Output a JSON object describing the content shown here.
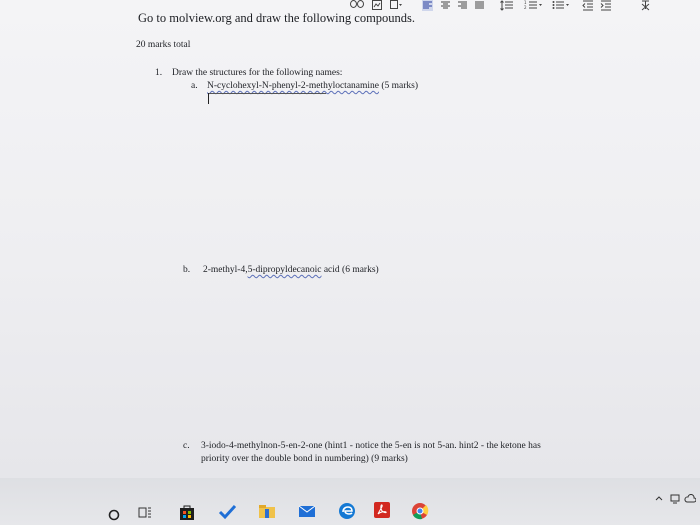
{
  "heading": "Go to molview.org and draw the following compounds.",
  "total_marks": "20 marks total",
  "question1": {
    "number": "1.",
    "text": "Draw the structures for the following names:",
    "a": {
      "letter": "a.",
      "name": "N-cyclohexyl-N-phenyl-2-methyloctanamine",
      "marks": "(5 marks)"
    },
    "b": {
      "letter": "b.",
      "name_prefix": "2-methyl-4,",
      "name_underlined": "5-dipropyldecanoic",
      "name_suffix": " acid (6 marks)"
    },
    "c": {
      "letter": "c.",
      "line1": "3-iodo-4-methylnon-5-en-2-one (hint1 - notice the 5-en is not 5-an. hint2 - the ketone has",
      "line2": "priority over the double bond in numbering) (9 marks)"
    }
  },
  "toolbar_icons": [
    "link-icon",
    "image-icon",
    "align-left-icon",
    "align-center-icon",
    "align-right-icon",
    "align-justify-icon",
    "line-spacing-icon",
    "numbered-list-icon",
    "bulleted-list-icon",
    "decrease-indent-icon",
    "increase-indent-icon",
    "clear-formatting-icon"
  ],
  "taskbar_icons": [
    "start-icon",
    "task-view-icon",
    "store-icon",
    "pinned-app-icon",
    "explorer-icon",
    "mail-icon",
    "edge-icon",
    "acrobat-icon",
    "chrome-icon"
  ],
  "colors": {
    "accent_blue": "#1f6fd6",
    "text": "#1d1f24"
  }
}
